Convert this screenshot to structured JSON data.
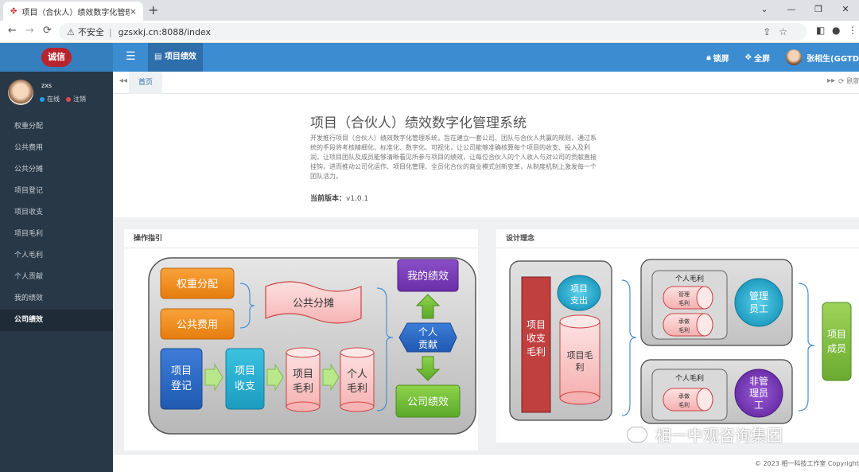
{
  "browser": {
    "tab_title": "项目（合伙人）绩效数字化管理系",
    "tab_close": "×",
    "new_tab": "+",
    "window_controls": [
      "⌄",
      "—",
      "❐",
      "✕"
    ],
    "security": "不安全",
    "url": "gzsxkj.cn:8088/index"
  },
  "header": {
    "logo_text": "诚信",
    "active_tab": "项目绩效",
    "lock_label": "锁屏",
    "fullscreen_label": "全屏",
    "user_name": "张相生(GGTD"
  },
  "sidebar": {
    "user": {
      "name": "zxs",
      "online": "在线",
      "logout": "注销"
    },
    "items": [
      {
        "label": "权重分配"
      },
      {
        "label": "公共费用"
      },
      {
        "label": "公共分摊"
      },
      {
        "label": "项目登记"
      },
      {
        "label": "项目收支"
      },
      {
        "label": "项目毛利"
      },
      {
        "label": "个人毛利"
      },
      {
        "label": "个人贡献"
      },
      {
        "label": "我的绩效"
      },
      {
        "label": "公司绩效"
      }
    ]
  },
  "breadcrumb": {
    "home": "首页",
    "refresh": "刷新"
  },
  "intro": {
    "title": "项目（合伙人）绩效数字化管理系统",
    "description": "开发推行项目（合伙人）绩效数字化管理系统，旨在建立一套公司、团队与合伙人共赢的规则，通过系统的手段将考核精细化、标准化、数字化、可视化，让公司能够准确核算每个项目的收支、投入及利润，让项目团队及成员能够清晰看见所参与项目的绩效，让每位合伙人的个人收入与对公司的贡献直接挂钩，进而推动公司化运作、项目化管理、全员化合伙的商业模式创新变革，从制度机制上激发每一个团队活力。",
    "version_label": "当前版本：",
    "version": "v1.0.1"
  },
  "guide": {
    "title": "操作指引",
    "weight": "权重分配",
    "fee": "公共费用",
    "share": "公共分摊",
    "reg_1": "项目",
    "reg_2": "登记",
    "inout_1": "项目",
    "inout_2": "收支",
    "pgross_1": "项目",
    "pgross_2": "毛利",
    "igross_1": "个人",
    "igross_2": "毛利",
    "contrib_1": "个人",
    "contrib_2": "贡献",
    "my_perf": "我的绩效",
    "co_perf": "公司绩效"
  },
  "design": {
    "title": "设计理念",
    "bar_1": "项目",
    "bar_2": "收支",
    "bar_3": "毛利",
    "expense_1": "项目",
    "expense_2": "支出",
    "gross_1": "项目毛",
    "gross_2": "利",
    "igross_a": "个人毛利",
    "mgmt_gross_1": "管理",
    "mgmt_gross_2": "毛利",
    "proj_gross_1": "承做",
    "proj_gross_2": "毛利",
    "mgr_1": "管理",
    "mgr_2": "员工",
    "igross_b": "个人毛利",
    "proj_gross_b1": "承做",
    "proj_gross_b2": "毛利",
    "nonmgr_1": "非管",
    "nonmgr_2": "理员",
    "nonmgr_3": "工",
    "member_1": "项目",
    "member_2": "成员"
  },
  "footer": "© 2023 相一科技工作室 Copyright",
  "watermark": "相一中观咨询集团"
}
